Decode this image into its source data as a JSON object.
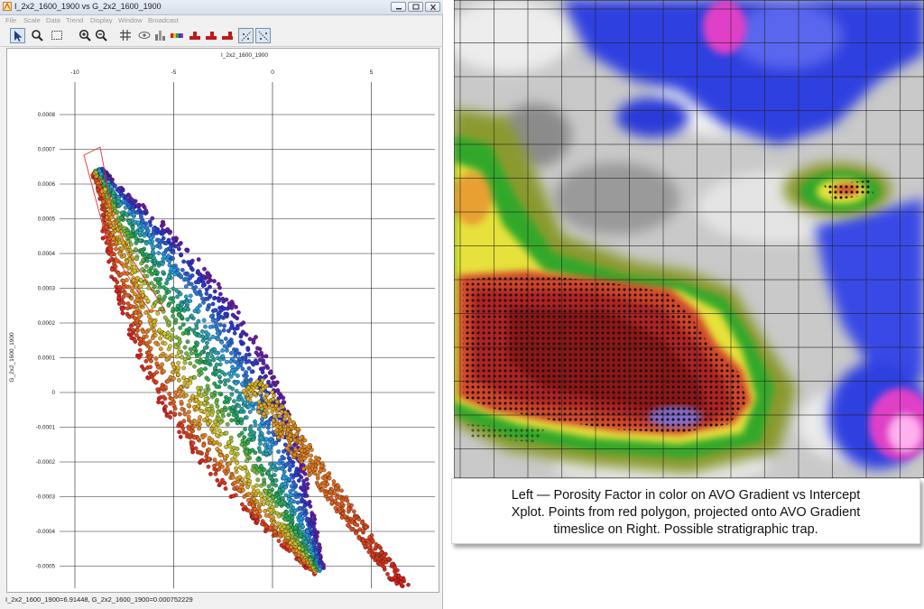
{
  "window": {
    "title": "I_2x2_1600_1900 vs G_2x2_1600_1900",
    "controls": [
      "minimize-icon",
      "maximize-icon",
      "close-icon"
    ]
  },
  "menu": [
    "File",
    "Scale",
    "Data",
    "Trend",
    "Display",
    "Window",
    "Broadcast"
  ],
  "toolbar": [
    "pointer-icon",
    "zoom-box-icon",
    "select-box-icon",
    "zoom-in-icon",
    "zoom-out-icon",
    "grid-icon",
    "eye-icon",
    "histogram-icon",
    "color-bar-icon",
    "trend-red-1-icon",
    "trend-red-2-icon",
    "trend-red-3-icon",
    "regression-1-icon",
    "regression-2-icon"
  ],
  "plot": {
    "x_axis_title": "I_2x2_1600_1900",
    "y_axis_title": "G_2x2_1600_1900",
    "x_ticks": [
      "-10",
      "-5",
      "0",
      "5"
    ],
    "y_ticks": [
      "0.0008",
      "0.0007",
      "0.0006",
      "0.0005",
      "0.0004",
      "0.0003",
      "0.0002",
      "0.0001",
      "0",
      "-0.0001",
      "-0.0002",
      "-0.0003",
      "-0.0004",
      "-0.0005"
    ],
    "polygon_color": "#e03030"
  },
  "status": "I_2x2_1600_1900=6.91448,  G_2x2_1600_1900=0.000752229",
  "caption": {
    "line1": "Left — Porosity Factor in color on AVO Gradient vs Intercept",
    "line2": "Xplot.  Points from red polygon, projected onto AVO Gradient",
    "line3": "timeslice on Right.  Possible stratigraphic trap."
  },
  "colors": {
    "map_blue": "#2f3fe0",
    "map_magenta": "#e040c8",
    "map_red": "#a11a16",
    "map_green": "#33a82a",
    "map_yellow": "#e6e23a"
  }
}
